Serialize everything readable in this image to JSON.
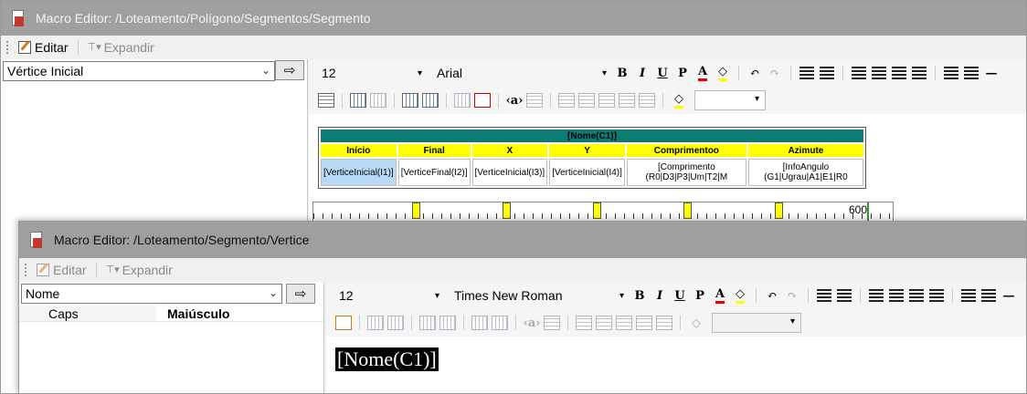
{
  "window_back": {
    "title": "Macro Editor: /Loteamento/Polígono/Segmentos/Segmento",
    "menu": {
      "edit": "Editar",
      "expand": "Expandir"
    },
    "combo_value": "Vértice Inicial",
    "go_glyph": "⇨",
    "toolbar": {
      "font_size": "12",
      "font_name": "Arial"
    },
    "table": {
      "header": "[Nome(C1)]",
      "columns": [
        "Início",
        "Final",
        "X",
        "Y",
        "Comprimentoo",
        "Azimute"
      ],
      "cells": [
        "[VerticeInicial(I1)]",
        "[VerticeFinal(I2)]",
        "[VerticeInicial(I3)]",
        "[VerticeInicial(I4)]",
        "[Comprimento (R0|D3|P3|Um|T2|M",
        "[InfoAngulo (G1|Ugrau|A1|E1|R0"
      ]
    },
    "ruler_value": "600"
  },
  "window_front": {
    "title": "Macro Editor: /Loteamento/Segmento/Vertice",
    "menu": {
      "edit": "Editar",
      "expand": "Expandir"
    },
    "combo_value": "Nome",
    "go_glyph": "⇨",
    "properties": [
      {
        "name": "Caps",
        "value": "Maiúsculo"
      }
    ],
    "toolbar": {
      "font_size": "12",
      "font_name": "Times New Roman"
    },
    "document_token": "[Nome(C1)]"
  },
  "icons": {
    "bold": "B",
    "italic": "I",
    "underline": "U",
    "paragraph": "P",
    "font_color": "A",
    "undo": "↶",
    "redo": "↷",
    "dropdown": "▾",
    "combo_arrow": "⌄"
  },
  "colors": {
    "header_teal": "#0b7b74",
    "column_yellow": "#ffff00",
    "selected_cell": "#b8daf6",
    "titlebar_gray": "#a0a0a0"
  }
}
